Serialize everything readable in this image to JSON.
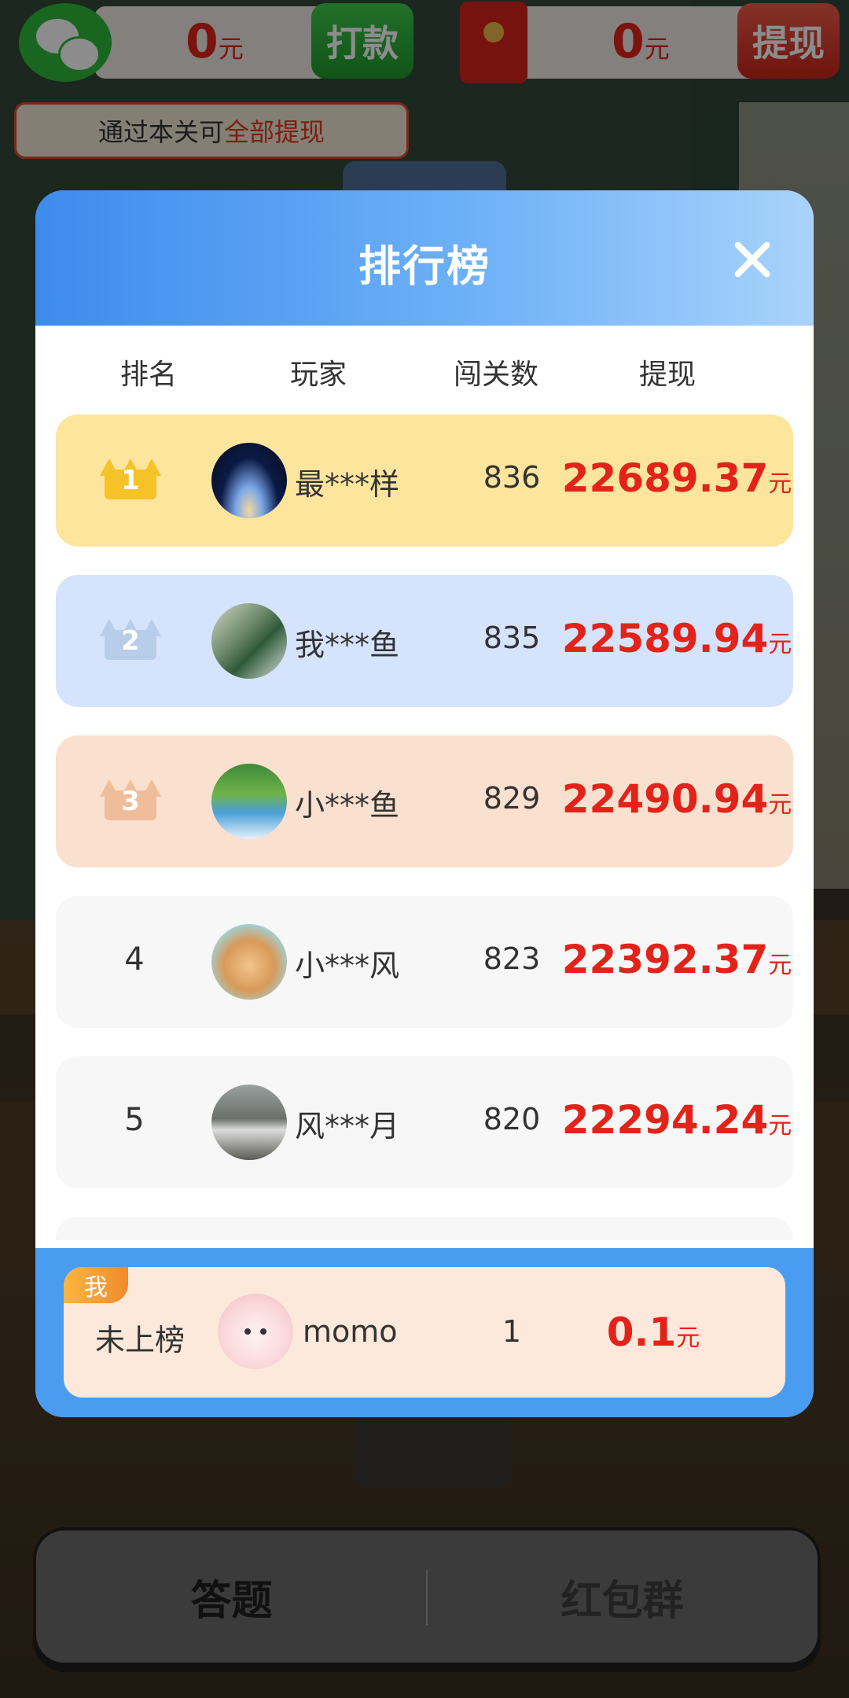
{
  "top_bar": {
    "wechat_amount": "0",
    "wechat_unit": "元",
    "transfer_label": "打款",
    "redpacket_amount": "0",
    "redpacket_unit": "元",
    "withdraw_label": "提现",
    "hint_prefix": "通过本关可",
    "hint_highlight": "全部提现"
  },
  "modal": {
    "title": "排行榜",
    "columns": [
      "排名",
      "玩家",
      "闯关数",
      "提现"
    ],
    "rows": [
      {
        "rank": "1",
        "name": "最***样",
        "levels": "836",
        "cash": "22689.37",
        "unit": "元"
      },
      {
        "rank": "2",
        "name": "我***鱼",
        "levels": "835",
        "cash": "22589.94",
        "unit": "元"
      },
      {
        "rank": "3",
        "name": "小***鱼",
        "levels": "829",
        "cash": "22490.94",
        "unit": "元"
      },
      {
        "rank": "4",
        "name": "小***风",
        "levels": "823",
        "cash": "22392.37",
        "unit": "元"
      },
      {
        "rank": "5",
        "name": "风***月",
        "levels": "820",
        "cash": "22294.24",
        "unit": "元"
      }
    ],
    "me": {
      "tag": "我",
      "rank": "未上榜",
      "name": "momo",
      "levels": "1",
      "cash": "0.1",
      "unit": "元"
    }
  },
  "bottom_nav": {
    "tabs": [
      {
        "label": "答题"
      },
      {
        "label": "红包群"
      }
    ]
  },
  "colors": {
    "rank1_bg": "#fde59d",
    "rank2_bg": "#d6e3fc",
    "rank3_bg": "#fae0cf",
    "other_bg": "#f7f7f7",
    "cash_red": "#e2231a",
    "header_blue": "#3d8bee"
  }
}
